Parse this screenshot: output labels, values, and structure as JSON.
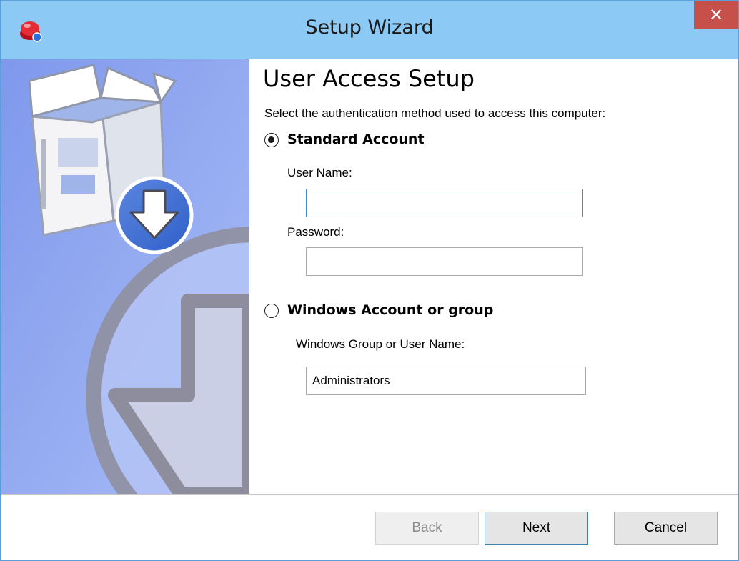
{
  "window": {
    "title": "Setup Wizard",
    "close_label": "✕"
  },
  "page": {
    "heading": "User Access Setup",
    "instruction": "Select the authentication method used to access this computer:"
  },
  "standard_account": {
    "label": "Standard Account",
    "selected": true,
    "username_label": "User Name:",
    "username_value": "",
    "password_label": "Password:",
    "password_value": ""
  },
  "windows_account": {
    "label": "Windows Account or group",
    "selected": false,
    "group_label": "Windows Group or User Name:",
    "group_value": "Administrators"
  },
  "buttons": {
    "back": "Back",
    "next": "Next",
    "cancel": "Cancel"
  },
  "icons": {
    "app": "setup-app-icon",
    "close": "close-icon",
    "banner": "install-box-download-icon"
  },
  "colors": {
    "titlebar": "#8ccaf5",
    "close_button": "#c7504a",
    "side_panel": "#8fa8ee"
  }
}
